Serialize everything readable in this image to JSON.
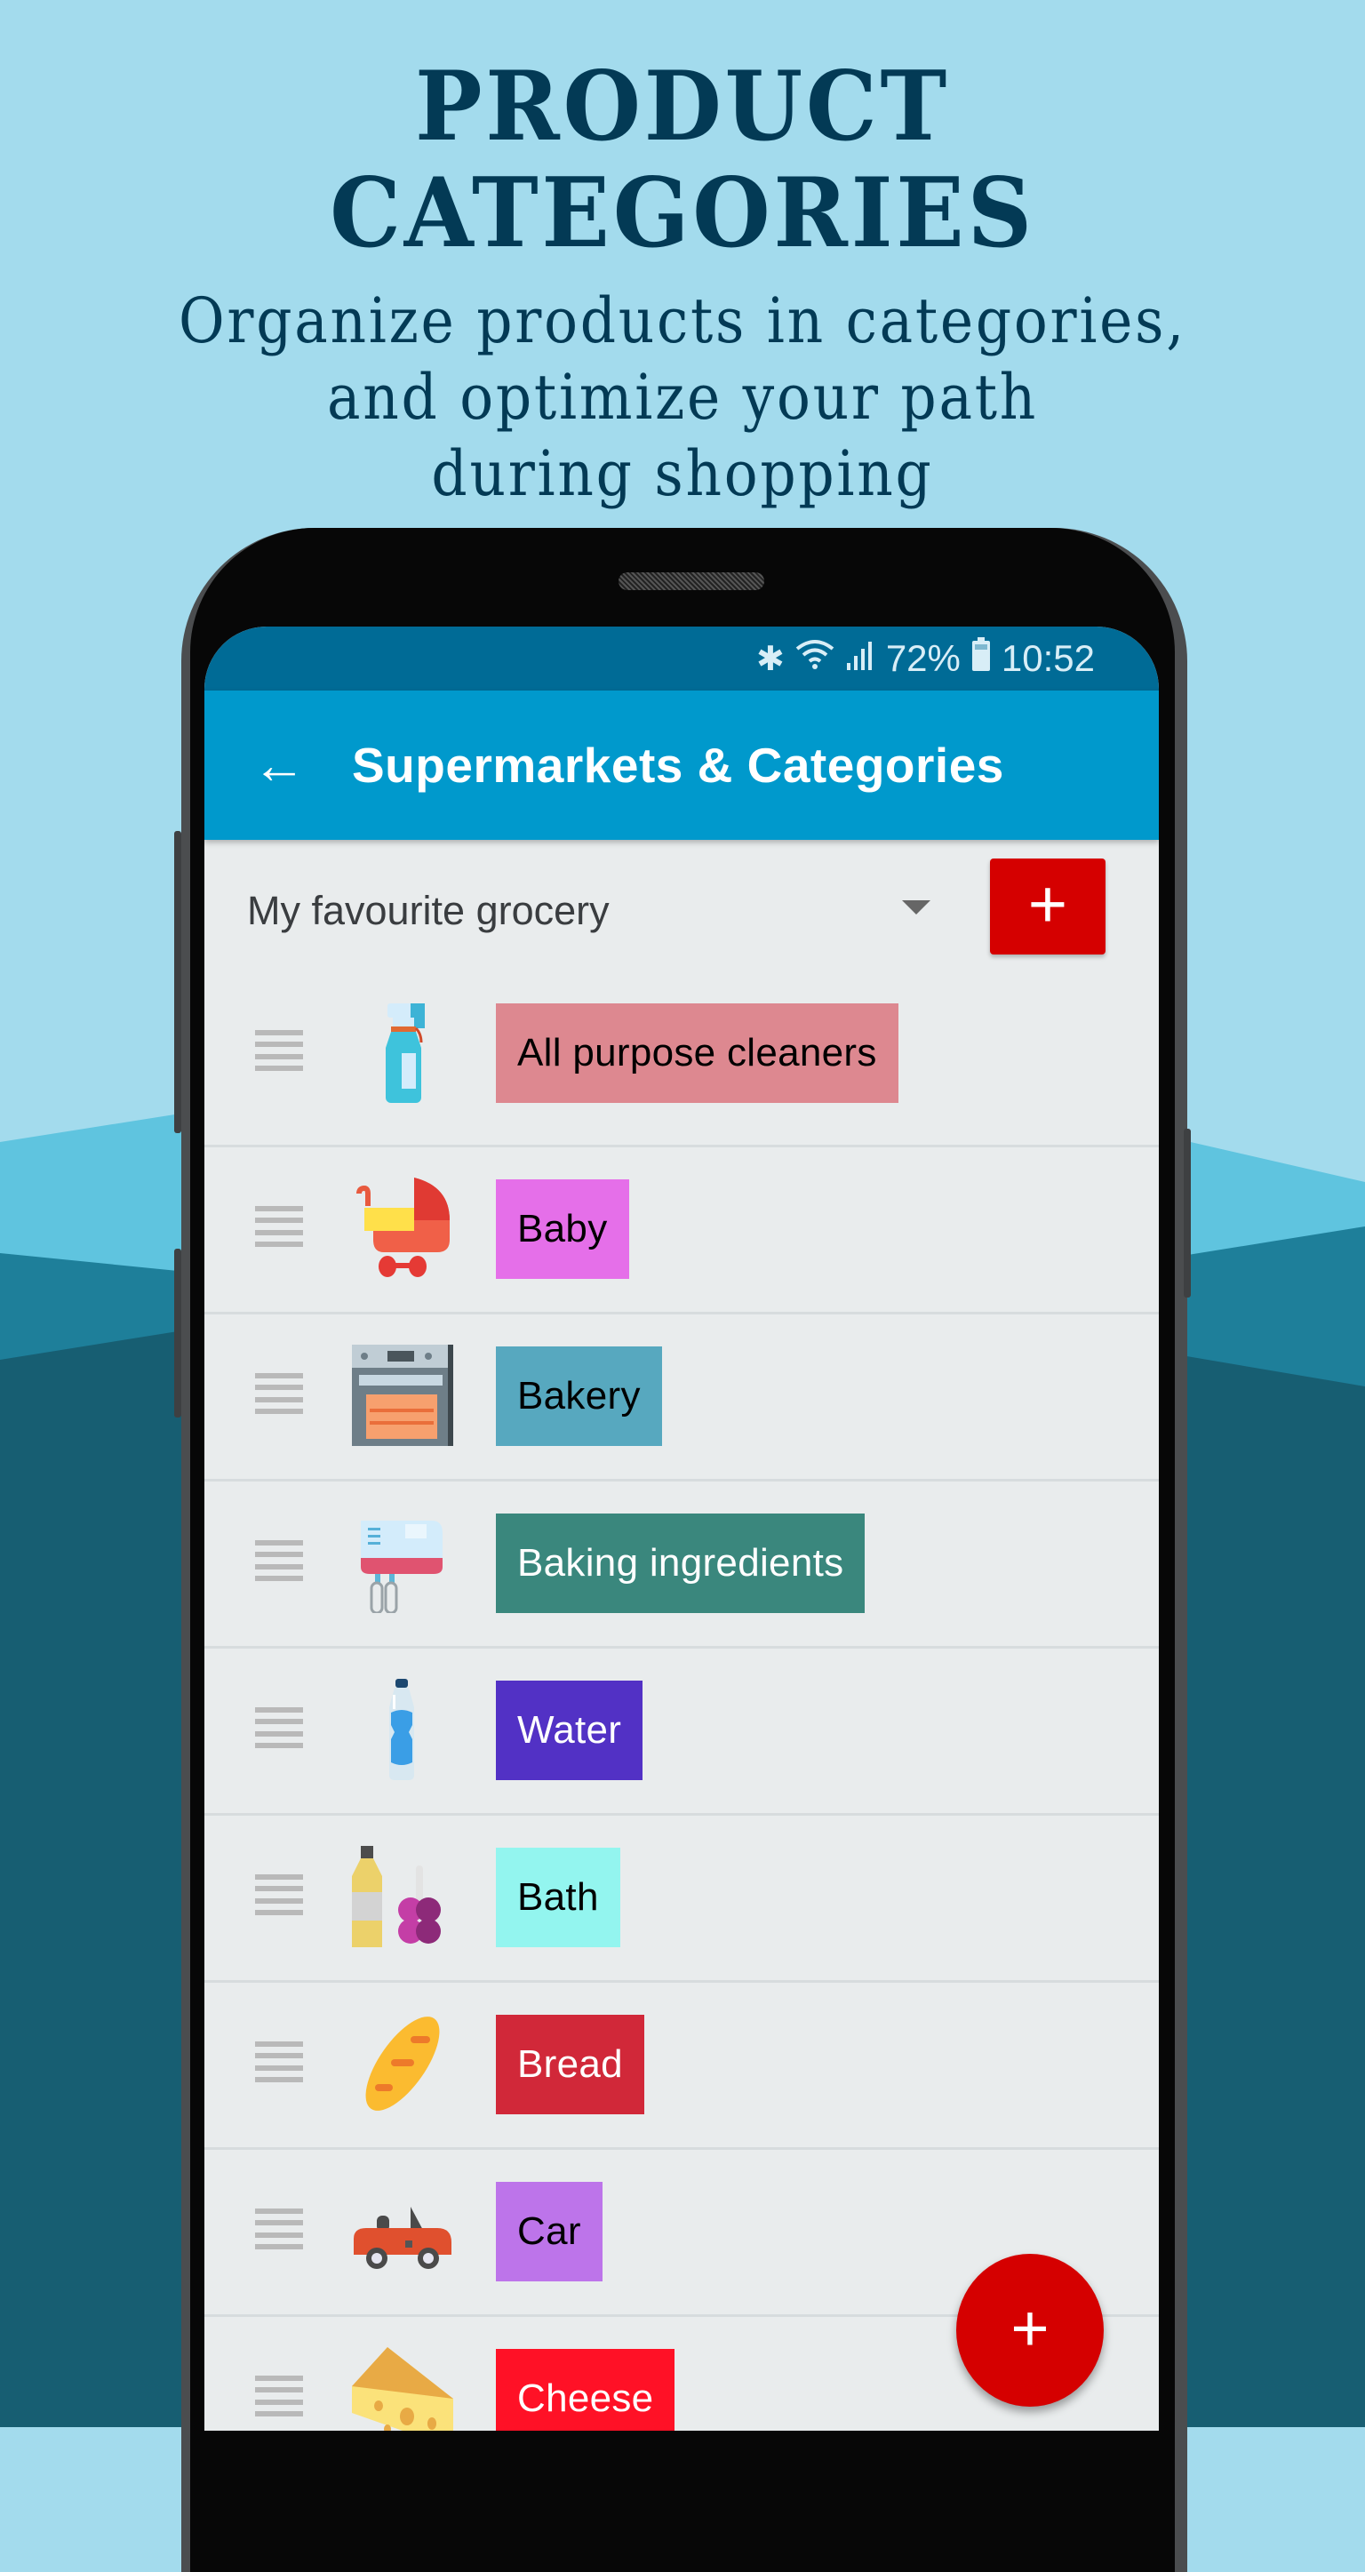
{
  "promo": {
    "headline": "PRODUCT CATEGORIES",
    "subtitle_lines": [
      "Organize products in categories,",
      "and optimize your path",
      "during shopping"
    ]
  },
  "status_bar": {
    "icons": [
      "bluetooth-icon",
      "wifi-icon",
      "signal-icon",
      "battery-icon"
    ],
    "battery": "72%",
    "time": "10:52"
  },
  "app_bar": {
    "back_icon": "←",
    "title": "Supermarkets & Categories",
    "color": "#0099cc"
  },
  "store_selector": {
    "selected": "My favourite grocery",
    "add_label": "+"
  },
  "categories": [
    {
      "label": "All purpose cleaners",
      "icon": "spray-bottle-icon",
      "color": "#dd8890",
      "text_color": "#000000"
    },
    {
      "label": "Baby",
      "icon": "baby-stroller-icon",
      "color": "#e56fe9",
      "text_color": "#000000"
    },
    {
      "label": "Bakery",
      "icon": "oven-icon",
      "color": "#57a8bf",
      "text_color": "#000000"
    },
    {
      "label": "Baking ingredients",
      "icon": "hand-mixer-icon",
      "color": "#3a877d",
      "text_color": "#ffffff"
    },
    {
      "label": "Water",
      "icon": "water-bottle-icon",
      "color": "#5231c5",
      "text_color": "#ffffff"
    },
    {
      "label": "Bath",
      "icon": "shampoo-sponge-icon",
      "color": "#93f5ef",
      "text_color": "#000000"
    },
    {
      "label": "Bread",
      "icon": "baguette-icon",
      "color": "#d12839",
      "text_color": "#ffffff"
    },
    {
      "label": "Car",
      "icon": "car-icon",
      "color": "#bd74ea",
      "text_color": "#000000"
    },
    {
      "label": "Cheese",
      "icon": "cheese-icon",
      "color": "#ff1126",
      "text_color": "#ffffff"
    }
  ],
  "fab": {
    "label": "+",
    "color": "#d50000"
  }
}
